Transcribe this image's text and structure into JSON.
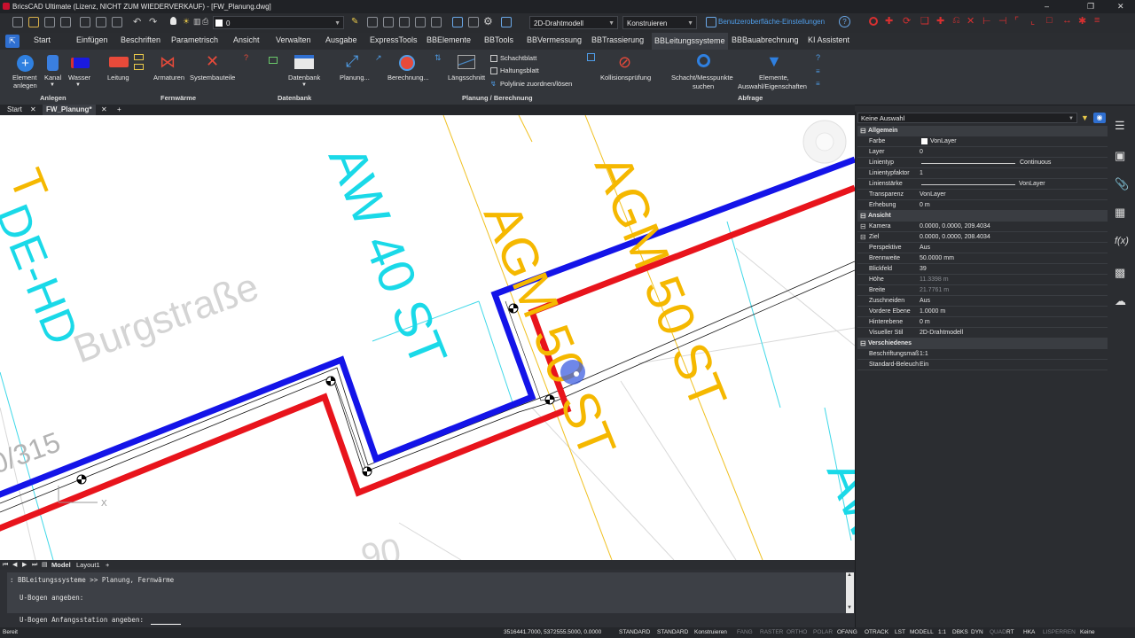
{
  "window": {
    "title": "BricsCAD Ultimate (Lizenz, NICHT ZUM WIEDERVERKAUF) - [FW_Planung.dwg]",
    "minimize": "–",
    "restore": "❐",
    "close": "✕"
  },
  "quick_access": {
    "layer_value": "0",
    "visual_style": "2D-Drahtmodell",
    "workspace": "Konstruieren",
    "ui_settings": "Benutzeroberfläche-Einstellungen"
  },
  "ribbon_tabs": [
    "Start",
    "Einfügen",
    "Beschriften",
    "Parametrisch",
    "Ansicht",
    "Verwalten",
    "Ausgabe",
    "ExpressTools",
    "BBElemente",
    "BBTools",
    "BBVermessung",
    "BBTrassierung",
    "BBLeitungssysteme",
    "BBBauabrechnung",
    "KI Assistent"
  ],
  "active_ribbon_tab": "BBLeitungssysteme",
  "ribbon": {
    "groups": {
      "anlegen": "Anlegen",
      "fernwaerme": "Fernwärme",
      "datenbank": "Datenbank",
      "planung": "Planung / Berechnung",
      "abfrage": "Abfrage"
    },
    "buttons": {
      "element_anlegen": "Element anlegen",
      "element_anlegen_l1": "Element",
      "element_anlegen_l2": "anlegen",
      "kanal": "Kanal",
      "wasser": "Wasser",
      "leitung": "Leitung",
      "armaturen": "Armaturen",
      "systembauteile": "Systembauteile",
      "datenbank": "Datenbank",
      "planung": "Planung...",
      "berechnung": "Berechnung...",
      "laengsschnitt": "Längsschnitt",
      "schachtblatt": "Schachtblatt",
      "haltungsblatt": "Haltungsblatt",
      "polylinie": "Polylinie zuordnen/lösen",
      "kollisionspruefung": "Kollisionsprüfung",
      "schacht_l1": "Schacht/Messpunkte",
      "schacht_l2": "suchen",
      "elemente_l1": "Elemente,",
      "elemente_l2": "Auswahl/Eigenschaften"
    }
  },
  "doc_tabs": {
    "start": "Start",
    "active": "FW_Planung*",
    "add": "+",
    "close": "✕"
  },
  "drawing": {
    "labels": {
      "street": "Burgstraße",
      "aw40": "AW 40 ST",
      "agm50a": "AGM 50 ST",
      "agm50b": "AGM 50 ST",
      "dehd": "DE-HD",
      "st_top": "T",
      "aw_right": "AW",
      "num315": "0/315",
      "num90": "90",
      "axis_x": "X"
    },
    "colors": {
      "supply": "#e8141c",
      "return": "#1414e8",
      "cyan_text": "#1ad9e8",
      "yellow_text": "#f5b800"
    }
  },
  "layout_tabs": {
    "model": "Model",
    "layout1": "Layout1",
    "add": "+"
  },
  "command_line": {
    "lines": [
      ": BBLeitungssysteme >> Planung, Fernwärme",
      "U-Bogen angeben:",
      "U-Bogen Anfangsstation angeben:"
    ]
  },
  "status_bar": {
    "ready": "Bereit",
    "coords": "3516441.7000, 5372555.5000, 0.0000",
    "items": [
      "STANDARD",
      "STANDARD",
      "Konstruieren",
      "FANG",
      "RASTER",
      "ORTHO",
      "POLAR",
      "OFANG",
      "OTRACK",
      "LST",
      "MODELL",
      "1:1",
      "DBKS",
      "DYN",
      "QUAD",
      "RT",
      "HKA",
      "LISPERREN",
      "Keine"
    ]
  },
  "properties": {
    "selection": "Keine Auswahl",
    "categories": {
      "allgemein": "Allgemein",
      "ansicht": "Ansicht",
      "verschiedenes": "Verschiedenes"
    },
    "allgemein": [
      {
        "k": "Farbe",
        "v": "VonLayer"
      },
      {
        "k": "Layer",
        "v": "0"
      },
      {
        "k": "Linientyp",
        "v": "Continuous"
      },
      {
        "k": "Linientypfaktor",
        "v": "1"
      },
      {
        "k": "Linienstärke",
        "v": "VonLayer"
      },
      {
        "k": "Transparenz",
        "v": "VonLayer"
      },
      {
        "k": "Erhebung",
        "v": "0 m"
      }
    ],
    "ansicht": [
      {
        "k": "Kamera",
        "v": "0.0000, 0.0000, 209.4034"
      },
      {
        "k": "Ziel",
        "v": "0.0000, 0.0000, 208.4034"
      },
      {
        "k": "Perspektive",
        "v": "Aus"
      },
      {
        "k": "Brennweite",
        "v": "50.0000 mm"
      },
      {
        "k": "Blickfeld",
        "v": "39"
      },
      {
        "k": "Höhe",
        "v": "11.3398 m"
      },
      {
        "k": "Breite",
        "v": "21.7761 m"
      },
      {
        "k": "Zuschneiden",
        "v": "Aus"
      },
      {
        "k": "Vordere Ebene",
        "v": "1.0000 m"
      },
      {
        "k": "Hinterebene",
        "v": "0 m"
      },
      {
        "k": "Visueller Stil",
        "v": "2D-Drahtmodell"
      }
    ],
    "verschiedenes": [
      {
        "k": "Beschriftungsmaßstab",
        "v": "1:1"
      },
      {
        "k": "Standard-Beleuchtung",
        "v": "Ein"
      }
    ]
  }
}
